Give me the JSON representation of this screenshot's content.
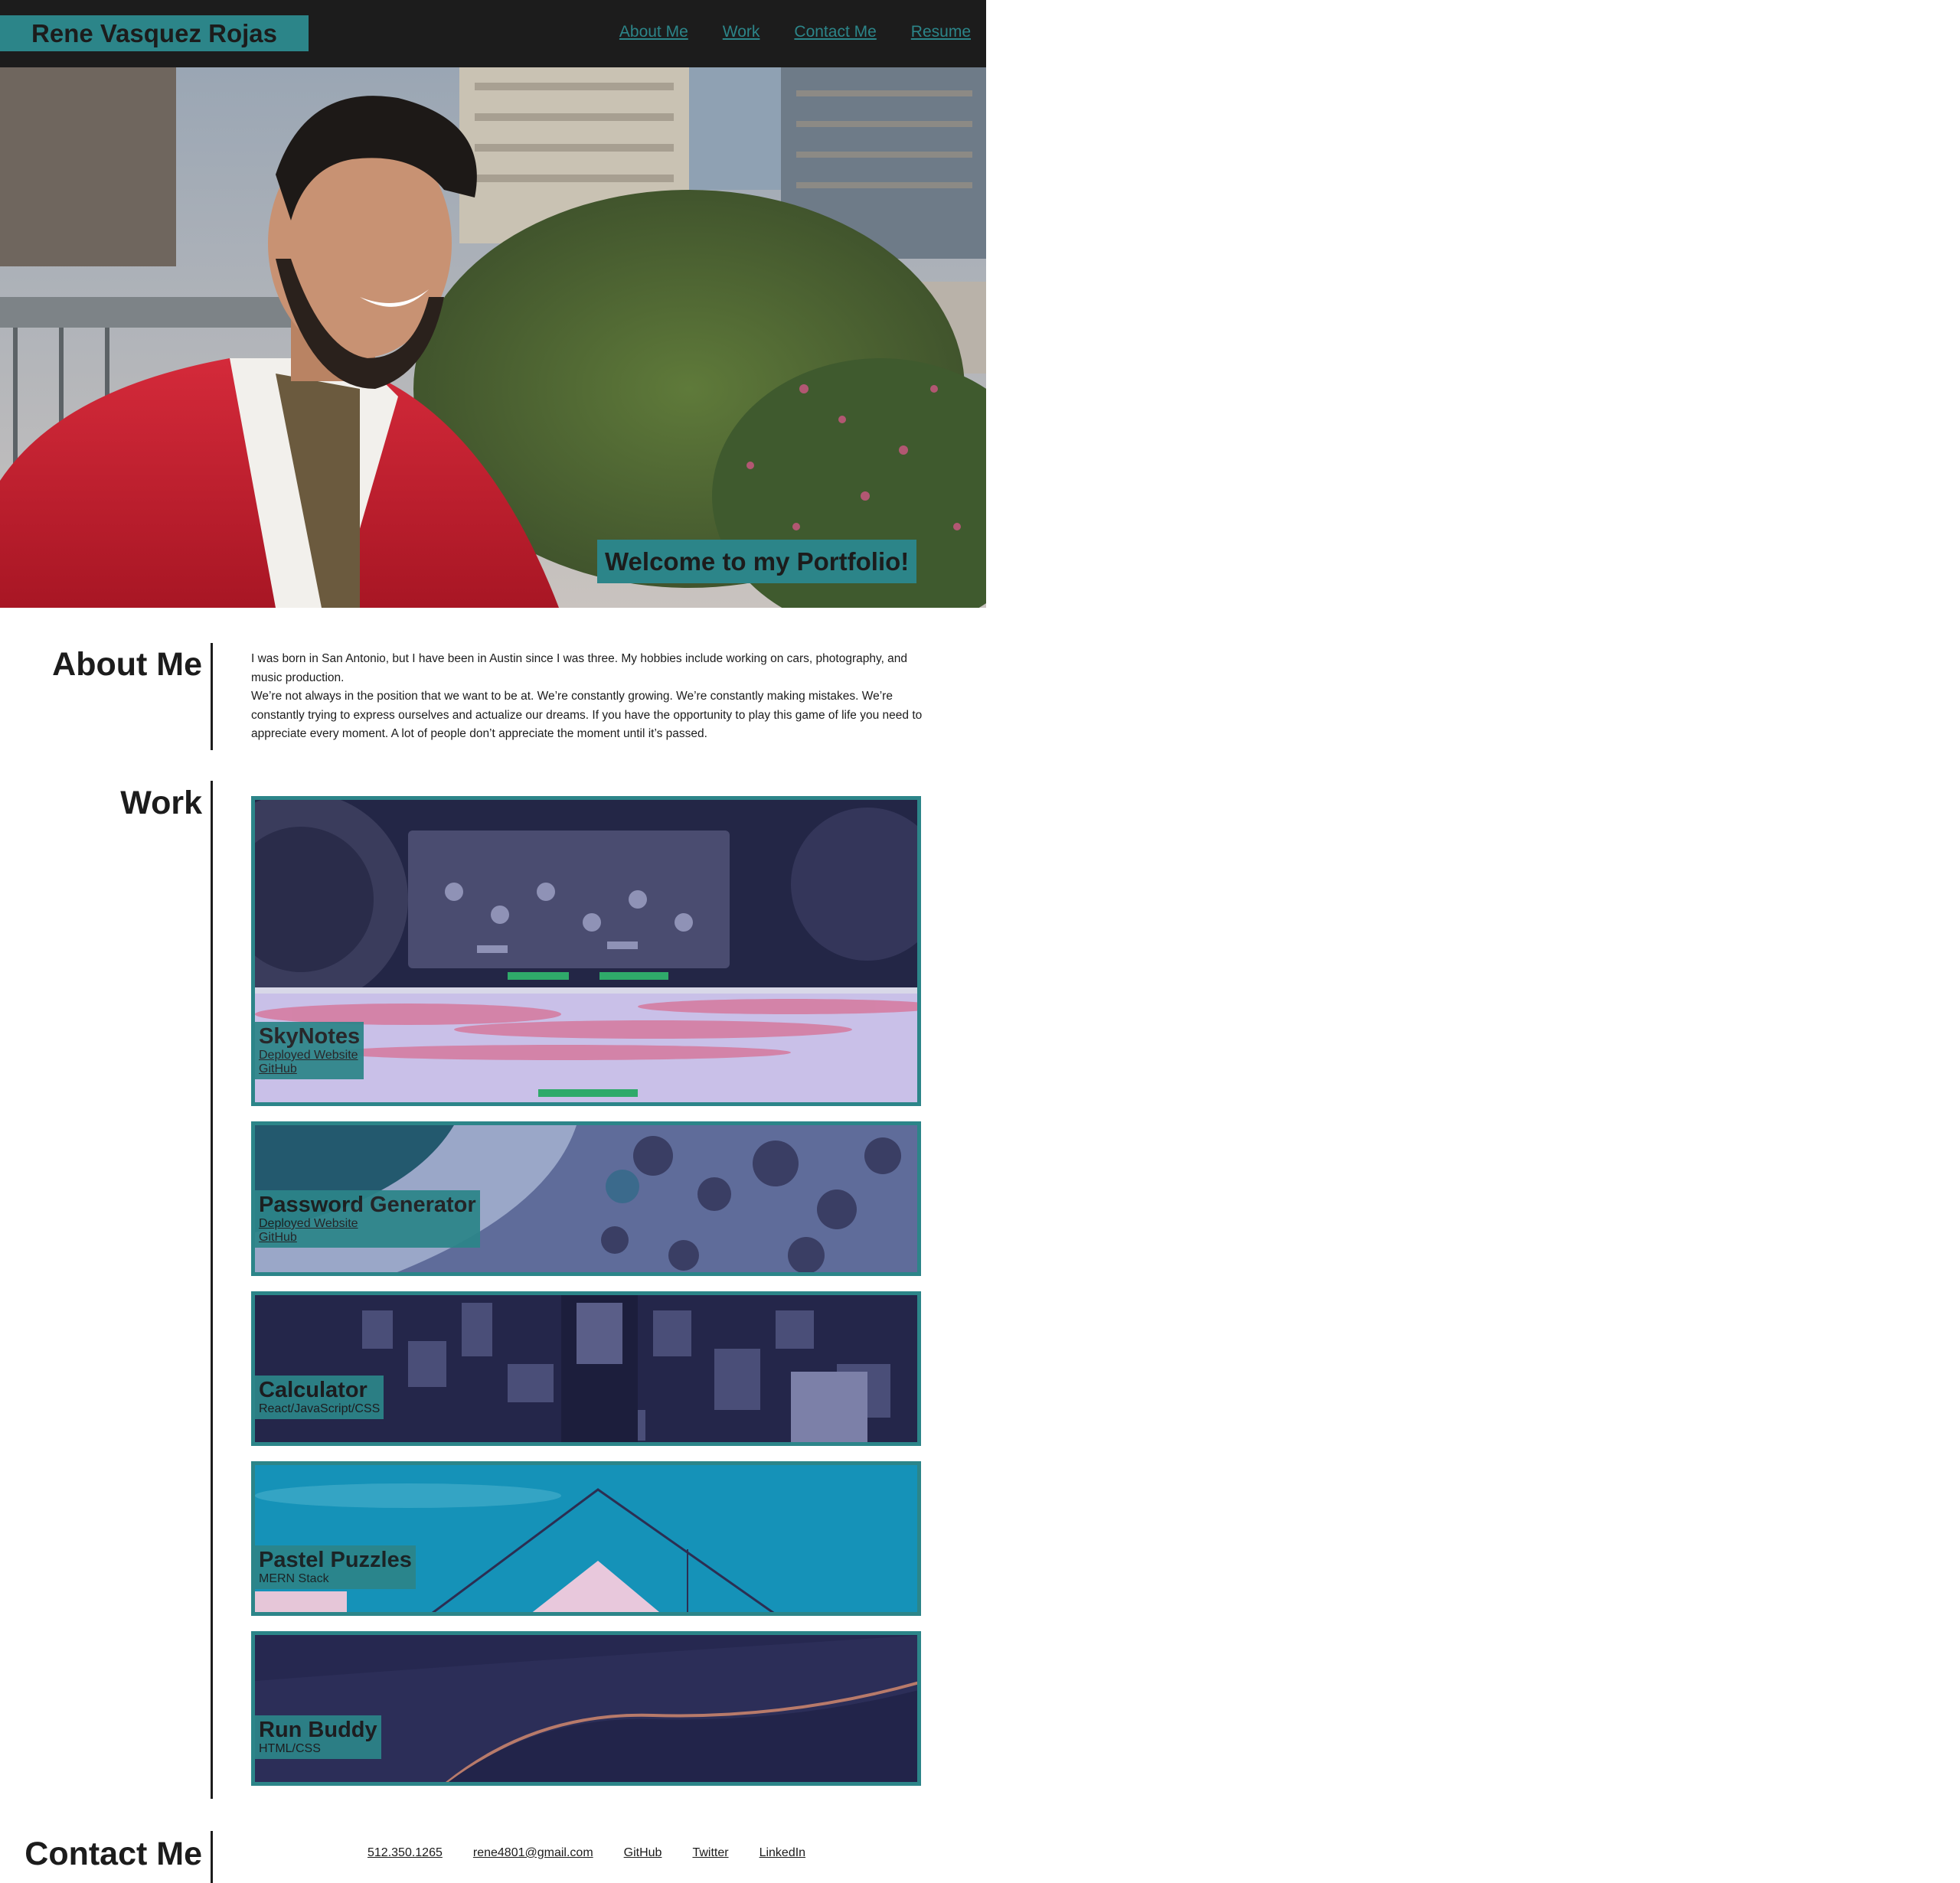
{
  "header": {
    "brand": "Rene Vasquez Rojas",
    "nav": [
      "About Me",
      "Work",
      "Contact Me",
      "Resume"
    ]
  },
  "hero": {
    "welcome": "Welcome to my Portfolio!"
  },
  "about": {
    "title": "About Me",
    "paragraphs": [
      "I was born in San Antonio, but I have been in Austin since I was three. My hobbies include working on cars, photography, and music production.",
      "We’re not always in the position that we want to be at. We’re constantly growing. We’re constantly making mistakes. We’re constantly trying to express ourselves and actualize our dreams. If you have the opportunity to play this game of life you need to appreciate every moment. A lot of people don’t appreciate the moment until it’s passed."
    ]
  },
  "work": {
    "title": "Work",
    "projects": [
      {
        "title": "SkyNotes",
        "link1": "Deployed Website",
        "link2": "GitHub"
      },
      {
        "title": "Password Generator",
        "link1": "Deployed Website",
        "link2": "GitHub"
      },
      {
        "title": "Calculator",
        "subtitle": "React/JavaScript/CSS"
      },
      {
        "title": "Pastel Puzzles",
        "subtitle": "MERN Stack"
      },
      {
        "title": "Run Buddy",
        "subtitle": "HTML/CSS"
      }
    ]
  },
  "contact": {
    "title": "Contact Me",
    "links": [
      "512.350.1265",
      "rene4801@gmail.com",
      "GitHub",
      "Twitter",
      "LinkedIn"
    ]
  },
  "colors": {
    "accent": "#2c8589",
    "header_bg": "#1c1c1c",
    "text": "#1c1c1c"
  }
}
